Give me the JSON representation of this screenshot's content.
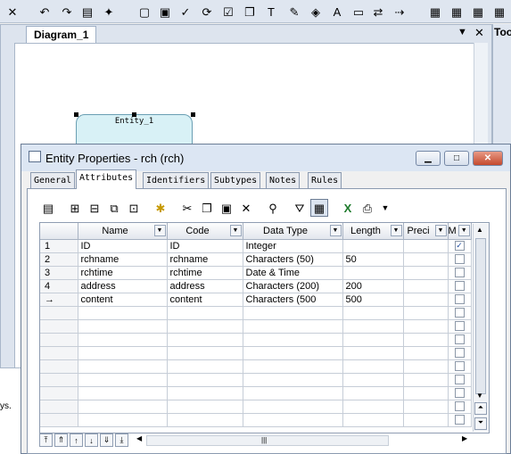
{
  "toolbar_icons": [
    "cut-icon",
    "undo-icon",
    "redo-icon",
    "properties-icon",
    "wand-icon",
    "new-icon",
    "open-icon",
    "check-icon",
    "refresh-icon",
    "checklist-icon",
    "window-icon",
    "text-icon",
    "pencil-icon",
    "paint-icon",
    "font-icon",
    "page-icon",
    "arrows-icon",
    "link-icon",
    "grid1-icon",
    "grid2-icon",
    "grid3-icon",
    "grid4-icon"
  ],
  "diagram": {
    "tab_label": "Diagram_1",
    "entity_label": "Entity_1"
  },
  "toolbox": {
    "title": "Too"
  },
  "output": {
    "text": "ys."
  },
  "dialog": {
    "title": "Entity Properties - rch (rch)",
    "tabs": [
      "General",
      "Attributes",
      "Identifiers",
      "Subtypes",
      "Notes",
      "Rules"
    ],
    "active_tab": "Attributes"
  },
  "grid": {
    "columns": [
      "Name",
      "Code",
      "Data Type",
      "Length",
      "Preci",
      "M"
    ],
    "rows": [
      {
        "num": "1",
        "name": "ID",
        "code": "ID",
        "type": "Integer",
        "length": "",
        "mandatory": true
      },
      {
        "num": "2",
        "name": "rchname",
        "code": "rchname",
        "type": "Characters (50)",
        "length": "50",
        "mandatory": false
      },
      {
        "num": "3",
        "name": "rchtime",
        "code": "rchtime",
        "type": "Date & Time",
        "length": "",
        "mandatory": false
      },
      {
        "num": "4",
        "name": "address",
        "code": "address",
        "type": "Characters (200)",
        "length": "200",
        "mandatory": false
      },
      {
        "num": "→",
        "name": "content",
        "code": "content",
        "type": "Characters (500",
        "length": "500",
        "mandatory": false
      }
    ],
    "empty_rows": 9
  }
}
